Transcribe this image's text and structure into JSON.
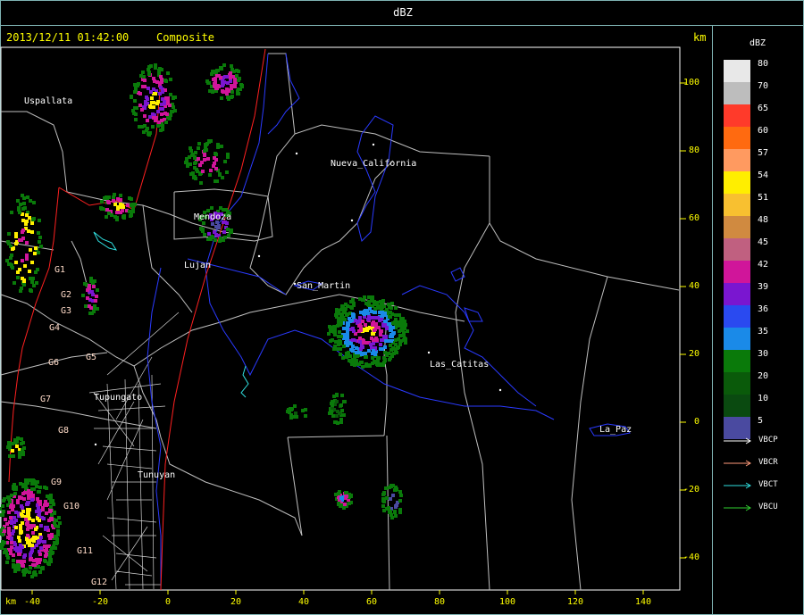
{
  "title": "dBZ",
  "timestamp": "2013/12/11 01:42:00",
  "product": "Composite",
  "unit_y": "km",
  "unit_x": "km",
  "places": [
    {
      "name": "Uspallata"
    },
    {
      "name": "Nueva_California"
    },
    {
      "name": "Mendoza"
    },
    {
      "name": "Lujan"
    },
    {
      "name": "San_Martin"
    },
    {
      "name": "Las_Catitas"
    },
    {
      "name": "Tupungato"
    },
    {
      "name": "Tunuyan"
    },
    {
      "name": "La_Paz"
    }
  ],
  "gauges": [
    "G1",
    "G2",
    "G3",
    "G4",
    "G5",
    "G6",
    "G7",
    "G8",
    "G9",
    "G10",
    "G11",
    "G12"
  ],
  "y_ticks": [
    "100",
    "80",
    "60",
    "40",
    "20",
    "0",
    "-20",
    "-40"
  ],
  "x_ticks": [
    "-40",
    "-20",
    "0",
    "20",
    "40",
    "60",
    "80",
    "100",
    "120",
    "140"
  ],
  "legend": {
    "title": "dBZ",
    "entries": [
      {
        "value": "80",
        "color": "#e8e8e8"
      },
      {
        "value": "70",
        "color": "#bdbdbd"
      },
      {
        "value": "65",
        "color": "#ff3a2a"
      },
      {
        "value": "60",
        "color": "#ff6a10"
      },
      {
        "value": "57",
        "color": "#ff9a60"
      },
      {
        "value": "54",
        "color": "#ffee00"
      },
      {
        "value": "51",
        "color": "#f8c030"
      },
      {
        "value": "48",
        "color": "#d08a40"
      },
      {
        "value": "45",
        "color": "#c06080"
      },
      {
        "value": "42",
        "color": "#d0159a"
      },
      {
        "value": "39",
        "color": "#7a16d0"
      },
      {
        "value": "36",
        "color": "#2a4af0"
      },
      {
        "value": "35",
        "color": "#1a8ae8"
      },
      {
        "value": "30",
        "color": "#0a7a0a"
      },
      {
        "value": "20",
        "color": "#0a5a0a"
      },
      {
        "value": "10",
        "color": "#0a4a10"
      },
      {
        "value": "5",
        "color": "#4a4aa0"
      }
    ]
  },
  "line_legend": [
    {
      "label": "VBCP",
      "color": "#ffffff"
    },
    {
      "label": "VBCR",
      "color": "#ff9a7a"
    },
    {
      "label": "VBCT",
      "color": "#30e0e0"
    },
    {
      "label": "VBCU",
      "color": "#30d030"
    }
  ]
}
